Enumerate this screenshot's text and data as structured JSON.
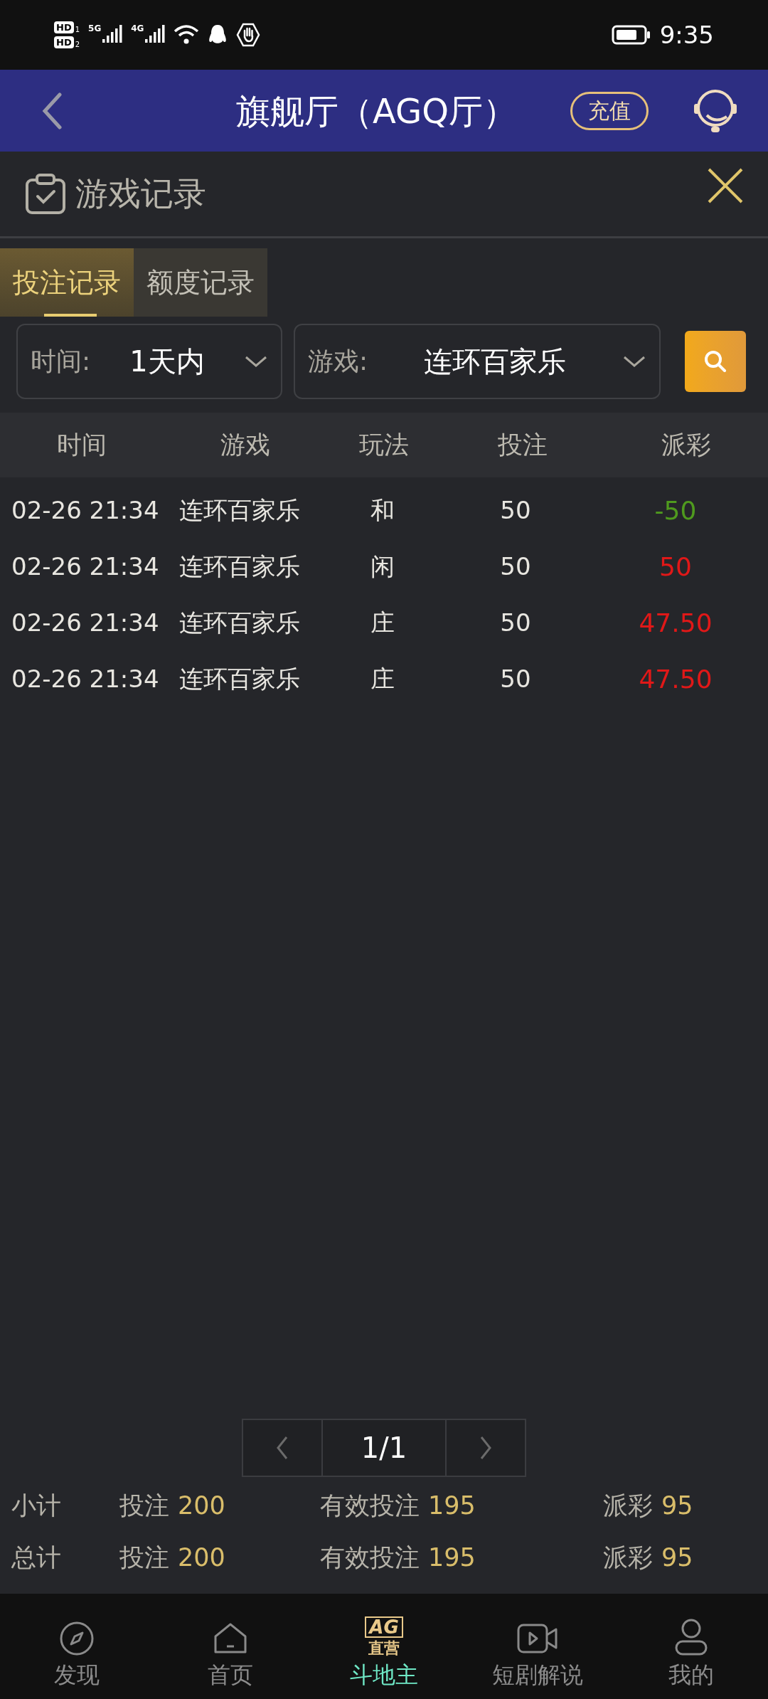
{
  "status_bar": {
    "sims": [
      {
        "label": "HD",
        "slot": "1"
      },
      {
        "label": "HD",
        "slot": "2"
      }
    ],
    "networks": [
      "5G",
      "4G"
    ],
    "time": "9:35"
  },
  "header": {
    "title": "旗舰厅（AGQ厅）",
    "recharge": "充值"
  },
  "panel": {
    "title": "游戏记录"
  },
  "tabs": [
    {
      "label": "投注记录",
      "selected": true
    },
    {
      "label": "额度记录",
      "selected": false
    }
  ],
  "filters": [
    {
      "label": "时间:",
      "value": "1天内"
    },
    {
      "label": "游戏:",
      "value": "连环百家乐"
    }
  ],
  "table": {
    "columns": [
      "时间",
      "游戏",
      "玩法",
      "投注",
      "派彩"
    ],
    "rows": [
      {
        "time": "02-26 21:34",
        "game": "连环百家乐",
        "bet_type": "和",
        "bet": "50",
        "payout": "-50",
        "color": "#4f9a1e"
      },
      {
        "time": "02-26 21:34",
        "game": "连环百家乐",
        "bet_type": "闲",
        "bet": "50",
        "payout": "50",
        "color": "#e01818"
      },
      {
        "time": "02-26 21:34",
        "game": "连环百家乐",
        "bet_type": "庄",
        "bet": "50",
        "payout": "47.50",
        "color": "#e01818"
      },
      {
        "time": "02-26 21:34",
        "game": "连环百家乐",
        "bet_type": "庄",
        "bet": "50",
        "payout": "47.50",
        "color": "#e01818"
      }
    ]
  },
  "pagination": {
    "page": "1/1"
  },
  "summary": [
    {
      "label": "小计",
      "items": [
        {
          "label": "投注",
          "value": "200"
        },
        {
          "label": "有效投注",
          "value": "195"
        },
        {
          "label": "派彩",
          "value": "95"
        }
      ]
    },
    {
      "label": "总计",
      "items": [
        {
          "label": "投注",
          "value": "200"
        },
        {
          "label": "有效投注",
          "value": "195"
        },
        {
          "label": "派彩",
          "value": "95"
        }
      ]
    }
  ],
  "bottom_nav": [
    {
      "kind": "compass",
      "label": "发现",
      "selected": false
    },
    {
      "kind": "home",
      "label": "首页",
      "selected": false
    },
    {
      "kind": "logo",
      "label": "斗地主",
      "selected": true,
      "logo_top": "AG",
      "logo_bottom": "直营"
    },
    {
      "kind": "video",
      "label": "短剧解说",
      "selected": false
    },
    {
      "kind": "person",
      "label": "我的",
      "selected": false
    }
  ]
}
